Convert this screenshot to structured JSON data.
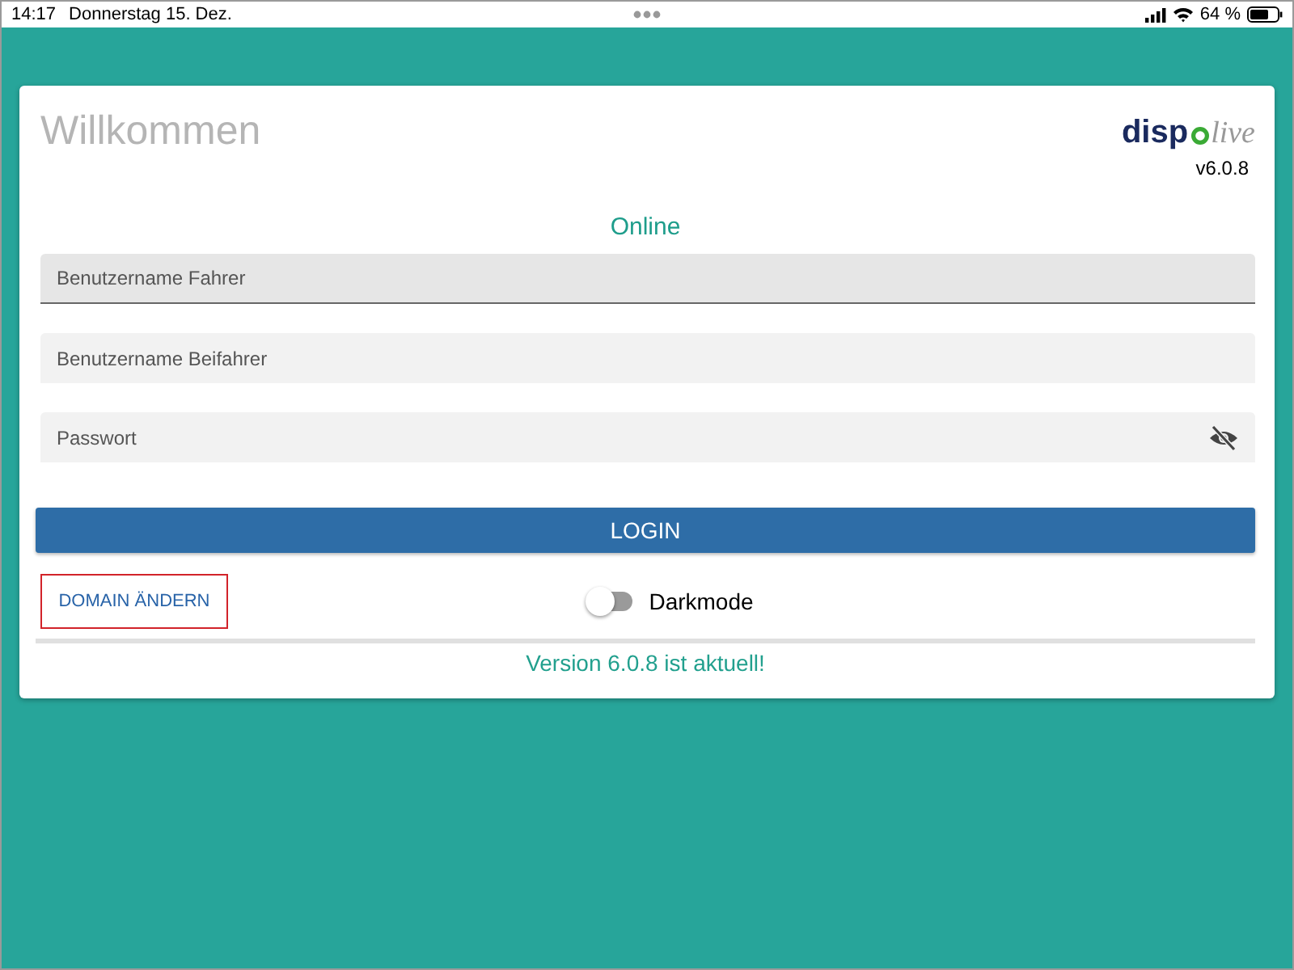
{
  "status_bar": {
    "time": "14:17",
    "date": "Donnerstag 15. Dez.",
    "battery": "64 %"
  },
  "card": {
    "title": "Willkommen",
    "logo": {
      "bold": "disp",
      "light": "live"
    },
    "version": "v6.0.8",
    "connection": "Online",
    "fields": [
      {
        "placeholder": "Benutzername Fahrer",
        "focused": true,
        "kind": "text"
      },
      {
        "placeholder": "Benutzername Beifahrer",
        "focused": false,
        "kind": "text"
      },
      {
        "placeholder": "Passwort",
        "focused": false,
        "kind": "password"
      }
    ],
    "login_button": "LOGIN",
    "domain_button": "DOMAIN ÄNDERN",
    "darkmode": {
      "label": "Darkmode",
      "on": false
    },
    "update_status": "Version 6.0.8 ist aktuell!"
  }
}
